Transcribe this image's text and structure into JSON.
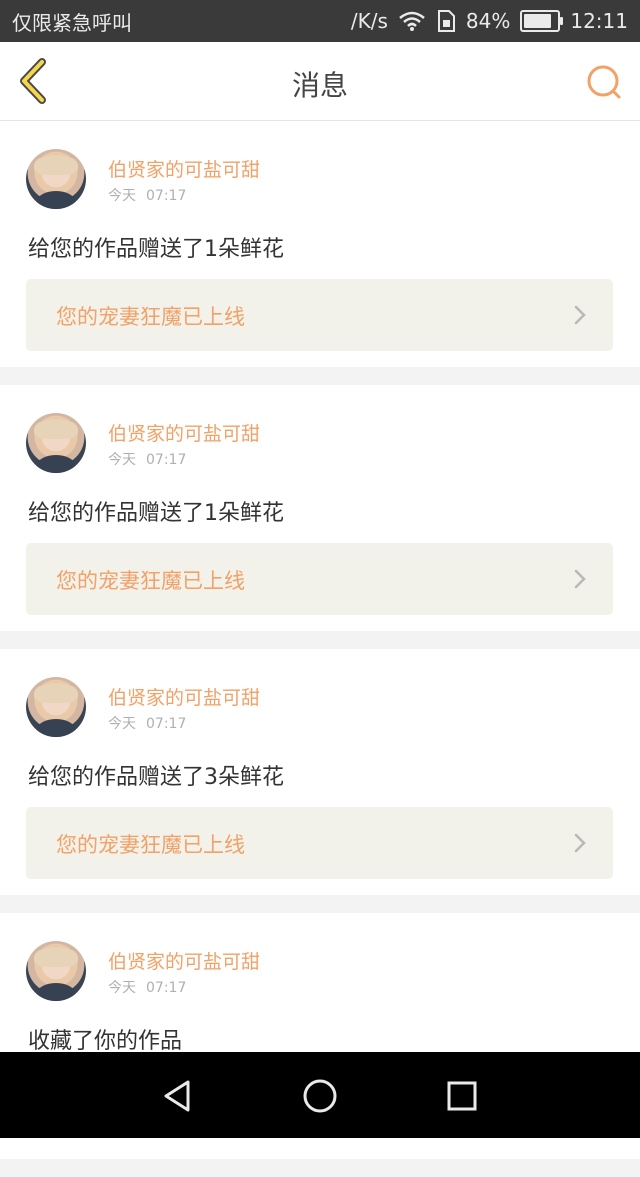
{
  "status_bar": {
    "left_text": "仅限紧急呼叫",
    "speed": "/K/s",
    "battery_percent": "84%",
    "battery_level": 0.84,
    "time": "12:11",
    "icons": [
      "wifi-icon",
      "sim-icon",
      "battery-icon"
    ]
  },
  "header": {
    "title": "消息",
    "back_icon": "chevron-left-icon",
    "search_icon": "search-icon",
    "accent_color": "#f2a167"
  },
  "messages": [
    {
      "sender": "伯贤家的可盐可甜",
      "day": "今天",
      "time": "07:17",
      "action": "给您的作品赠送了1朵鲜花",
      "work_title": "您的宠妻狂魔已上线"
    },
    {
      "sender": "伯贤家的可盐可甜",
      "day": "今天",
      "time": "07:17",
      "action": "给您的作品赠送了1朵鲜花",
      "work_title": "您的宠妻狂魔已上线"
    },
    {
      "sender": "伯贤家的可盐可甜",
      "day": "今天",
      "time": "07:17",
      "action": "给您的作品赠送了3朵鲜花",
      "work_title": "您的宠妻狂魔已上线"
    },
    {
      "sender": "伯贤家的可盐可甜",
      "day": "今天",
      "time": "07:17",
      "action": "收藏了你的作品",
      "work_title": ""
    }
  ],
  "system_nav": {
    "back": "back-triangle-icon",
    "home": "home-circle-icon",
    "recents": "recents-square-icon"
  }
}
